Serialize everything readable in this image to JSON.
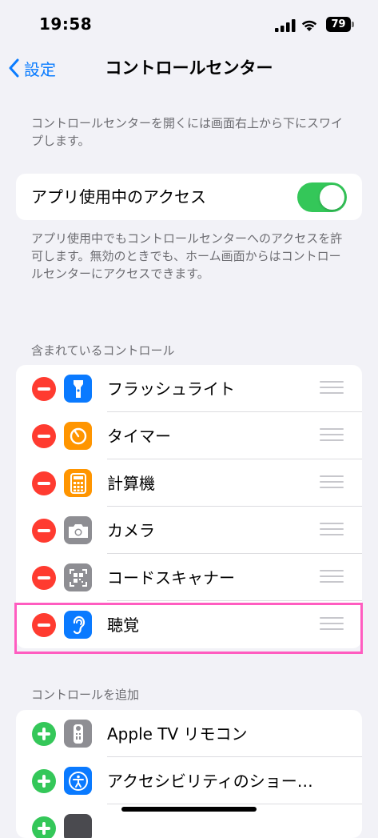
{
  "status": {
    "time": "19:58",
    "battery": "79"
  },
  "nav": {
    "back_label": "設定",
    "title": "コントロールセンター"
  },
  "intro_note": "コントロールセンターを開くには画面右上から下にスワイプします。",
  "access": {
    "label": "アプリ使用中のアクセス",
    "enabled": true
  },
  "access_note": "アプリ使用中でもコントロールセンターへのアクセスを許可します。無効のときでも、ホーム画面からはコントロールセンターにアクセスできます。",
  "included": {
    "header": "含まれているコントロール",
    "items": [
      {
        "label": "フラッシュライト",
        "icon": "flashlight-icon",
        "color": "#0a7aff"
      },
      {
        "label": "タイマー",
        "icon": "timer-icon",
        "color": "#ff9500"
      },
      {
        "label": "計算機",
        "icon": "calculator-icon",
        "color": "#ff9500"
      },
      {
        "label": "カメラ",
        "icon": "camera-icon",
        "color": "#8e8e93"
      },
      {
        "label": "コードスキャナー",
        "icon": "qr-code-icon",
        "color": "#8e8e93"
      },
      {
        "label": "聴覚",
        "icon": "ear-icon",
        "color": "#0a7aff"
      }
    ]
  },
  "more": {
    "header": "コントロールを追加",
    "items": [
      {
        "label": "Apple TV リモコン",
        "icon": "remote-icon",
        "color": "#8e8e93"
      },
      {
        "label": "アクセシビリティのショー…",
        "icon": "accessibility-icon",
        "color": "#0a7aff"
      }
    ]
  },
  "colors": {
    "accent": "#0a7cff",
    "toggle_on": "#34c759",
    "remove": "#ff3b30",
    "add": "#34c759",
    "highlight": "#ff5cc0"
  }
}
